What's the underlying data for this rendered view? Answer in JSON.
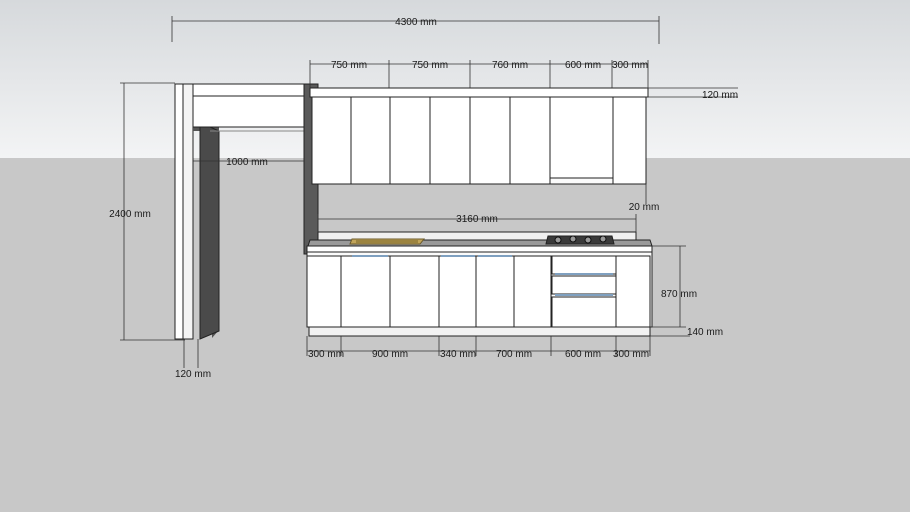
{
  "colors": {
    "sky_top": "#d9dcdf",
    "sky_bottom": "#f2f3f4",
    "ground": "#c8c8c8",
    "cabinet": "#ffffff",
    "wall_shadow": "#4a4a4a",
    "line": "#222222"
  },
  "dimensions": {
    "total_width": "4300 mm",
    "upper_1": "750 mm",
    "upper_2": "750 mm",
    "upper_3": "760 mm",
    "upper_4": "600 mm",
    "upper_5": "300 mm",
    "upper_depth": "120 mm",
    "beam_length": "1000 mm",
    "height_total": "2400 mm",
    "counter_width": "3160 mm",
    "gap": "20 mm",
    "base_height": "870 mm",
    "plinth": "140 mm",
    "base_1": "300 mm",
    "base_2": "900 mm",
    "base_3": "340 mm",
    "base_4": "700 mm",
    "base_5": "600 mm",
    "base_6": "300 mm",
    "pillar_width": "120 mm"
  }
}
